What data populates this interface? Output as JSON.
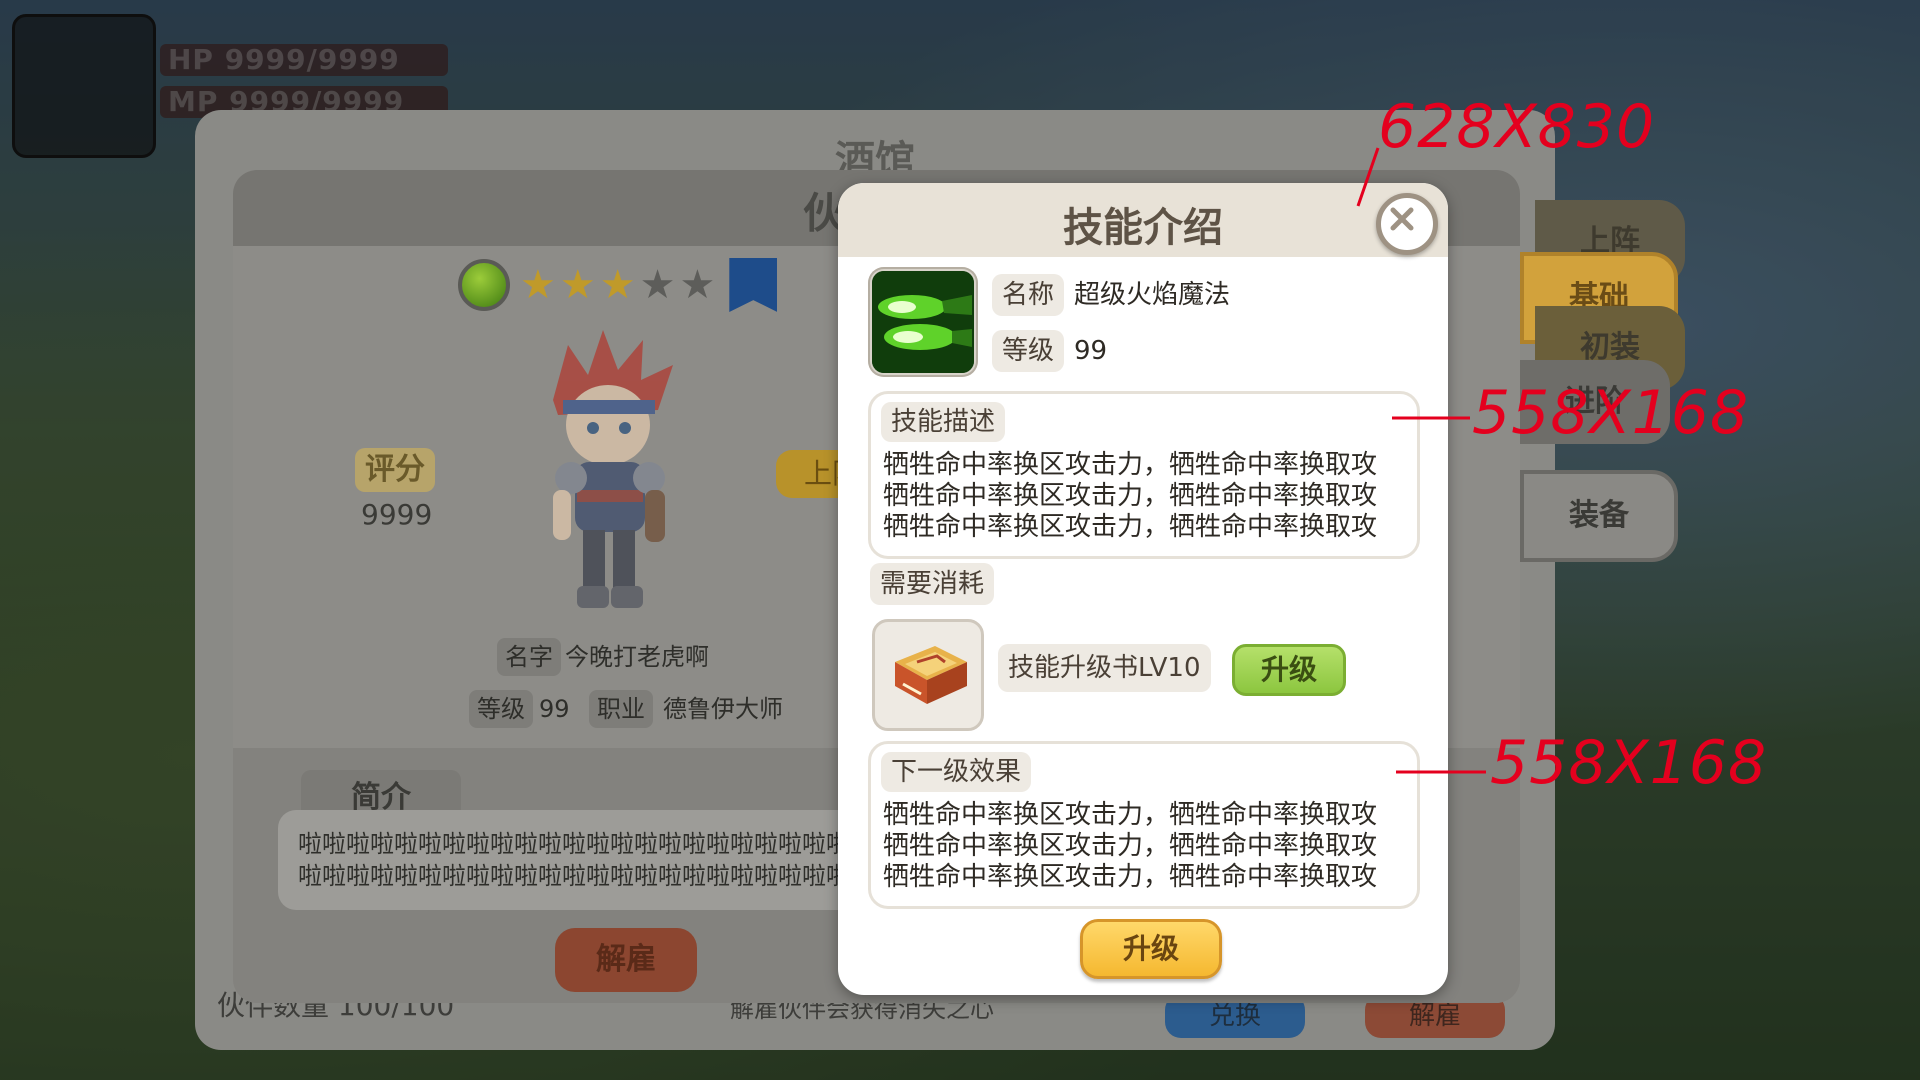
{
  "hud": {
    "hp_label": "HP 9999/9999",
    "mp_label": "MP 9999/9999"
  },
  "tavern": {
    "title": "酒馆",
    "footer_count_label": "伙伴数量 100/100",
    "footer_hint": "解雇伙伴会获得消失之心",
    "btn_blue": "兑换",
    "btn_red": "解雇"
  },
  "side_tabs": [
    {
      "label": "上阵",
      "color": "#6b5f3d"
    },
    {
      "label": "基础",
      "color": "#d9a43a"
    },
    {
      "label": "初装",
      "color": "#6b5f3d"
    },
    {
      "label": "进阶",
      "color": "#6b6a66"
    },
    {
      "label": "装备",
      "color": "#8a8985"
    }
  ],
  "partner": {
    "title": "伙",
    "stars_filled": 3,
    "stars_total": 5,
    "score_label": "评分",
    "score_value": "9999",
    "goto_label": "上阵",
    "name_label": "名字",
    "name_value": "今晚打老虎啊",
    "level_label": "等级",
    "level_value": "99",
    "job_label": "职业",
    "job_value": "德鲁伊大师",
    "intro_title": "简介",
    "intro_lines": [
      "啦啦啦啦啦啦啦啦啦啦啦啦啦啦啦啦啦啦啦啦啦啦啦",
      "啦啦啦啦啦啦啦啦啦啦啦啦啦啦啦啦啦啦啦啦啦啦啦"
    ],
    "dismiss_label": "解雇"
  },
  "skill": {
    "title": "技能介绍",
    "name_label": "名称",
    "name_value": "超级火焰魔法",
    "level_label": "等级",
    "level_value": "99",
    "desc_title": "技能描述",
    "desc_lines": [
      "牺牲命中率换区攻击力，牺牲命中率换取攻",
      "牺牲命中率换区攻击力，牺牲命中率换取攻",
      "牺牲命中率换区攻击力，牺牲命中率换取攻"
    ],
    "cost_title": "需要消耗",
    "cost_item": "技能升级书LV10",
    "upgrade_small_label": "升级",
    "next_title": "下一级效果",
    "next_lines": [
      "牺牲命中率换区攻击力，牺牲命中率换取攻",
      "牺牲命中率换区攻击力，牺牲命中率换取攻",
      "牺牲命中率换区攻击力，牺牲命中率换取攻"
    ],
    "upgrade_label": "升级"
  },
  "annotations": {
    "dialog_size": "628X830",
    "desc_size": "558X168",
    "next_size": "558X168",
    "color": "#e4001e"
  }
}
